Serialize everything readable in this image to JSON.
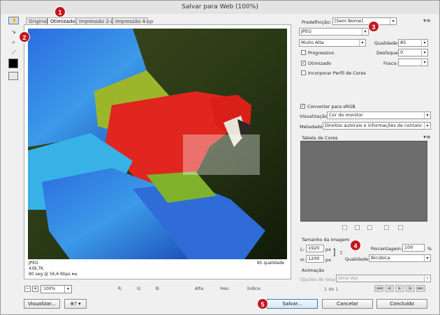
{
  "window": {
    "title": "Salvar para Web (100%)"
  },
  "tabs": [
    "Original",
    "Otimizado",
    "Impressão 2-up",
    "Impressão 4-up"
  ],
  "tools": [
    "hand-icon",
    "slice-select-icon",
    "zoom-icon",
    "eyedropper-icon"
  ],
  "image_info": {
    "format": "JPEG",
    "size": "439,7K",
    "time": "80 seg @ 56,6 Kbps",
    "quality_note": "85 qualidade"
  },
  "bottom": {
    "zoom_value": "100%",
    "readouts": [
      "R:",
      "G:",
      "B:",
      "Alfa:",
      "Hex:",
      "Índice:"
    ]
  },
  "settings": {
    "preset_label": "Predefinição:",
    "preset_value": "[Sem Nome]",
    "format_value": "JPEG",
    "compression_value": "Muito Alta",
    "quality_label": "Qualidade:",
    "quality_value": "85",
    "progressive_label": "Progressivo",
    "progressive_checked": false,
    "blur_label": "Desfoque:",
    "blur_value": "0",
    "optimized_label": "Otimizado",
    "optimized_checked": true,
    "matte_label": "Fosco:",
    "embed_profile_label": "Incorporar Perfil de Cores",
    "embed_profile_checked": false,
    "srgb_label": "Converter para sRGB",
    "srgb_checked": true,
    "preview_label": "Visualização:",
    "preview_value": "Cor do monitor",
    "metadata_label": "Metadados:",
    "metadata_value": "Direitos autorais e informações de contato"
  },
  "color_table": {
    "title": "Tabela de Cores"
  },
  "image_size": {
    "title": "Tamanho da Imagem",
    "w_label": "L:",
    "w_value": "1920",
    "h_label": "H:",
    "h_value": "1200",
    "unit": "px",
    "percent_label": "Porcentagem:",
    "percent_value": "100",
    "percent_unit": "%",
    "quality_label": "Qualidade:",
    "quality_value": "Bicúbica"
  },
  "animation": {
    "title": "Animação",
    "loop_label": "Opções de loop:",
    "loop_value": "Uma Vez",
    "frame_counter": "1 de 1"
  },
  "buttons": {
    "preview": "Visualizar...",
    "save": "Salvar...",
    "cancel": "Cancelar",
    "done": "Concluído"
  },
  "badges": [
    "1",
    "2",
    "3",
    "4",
    "5"
  ]
}
